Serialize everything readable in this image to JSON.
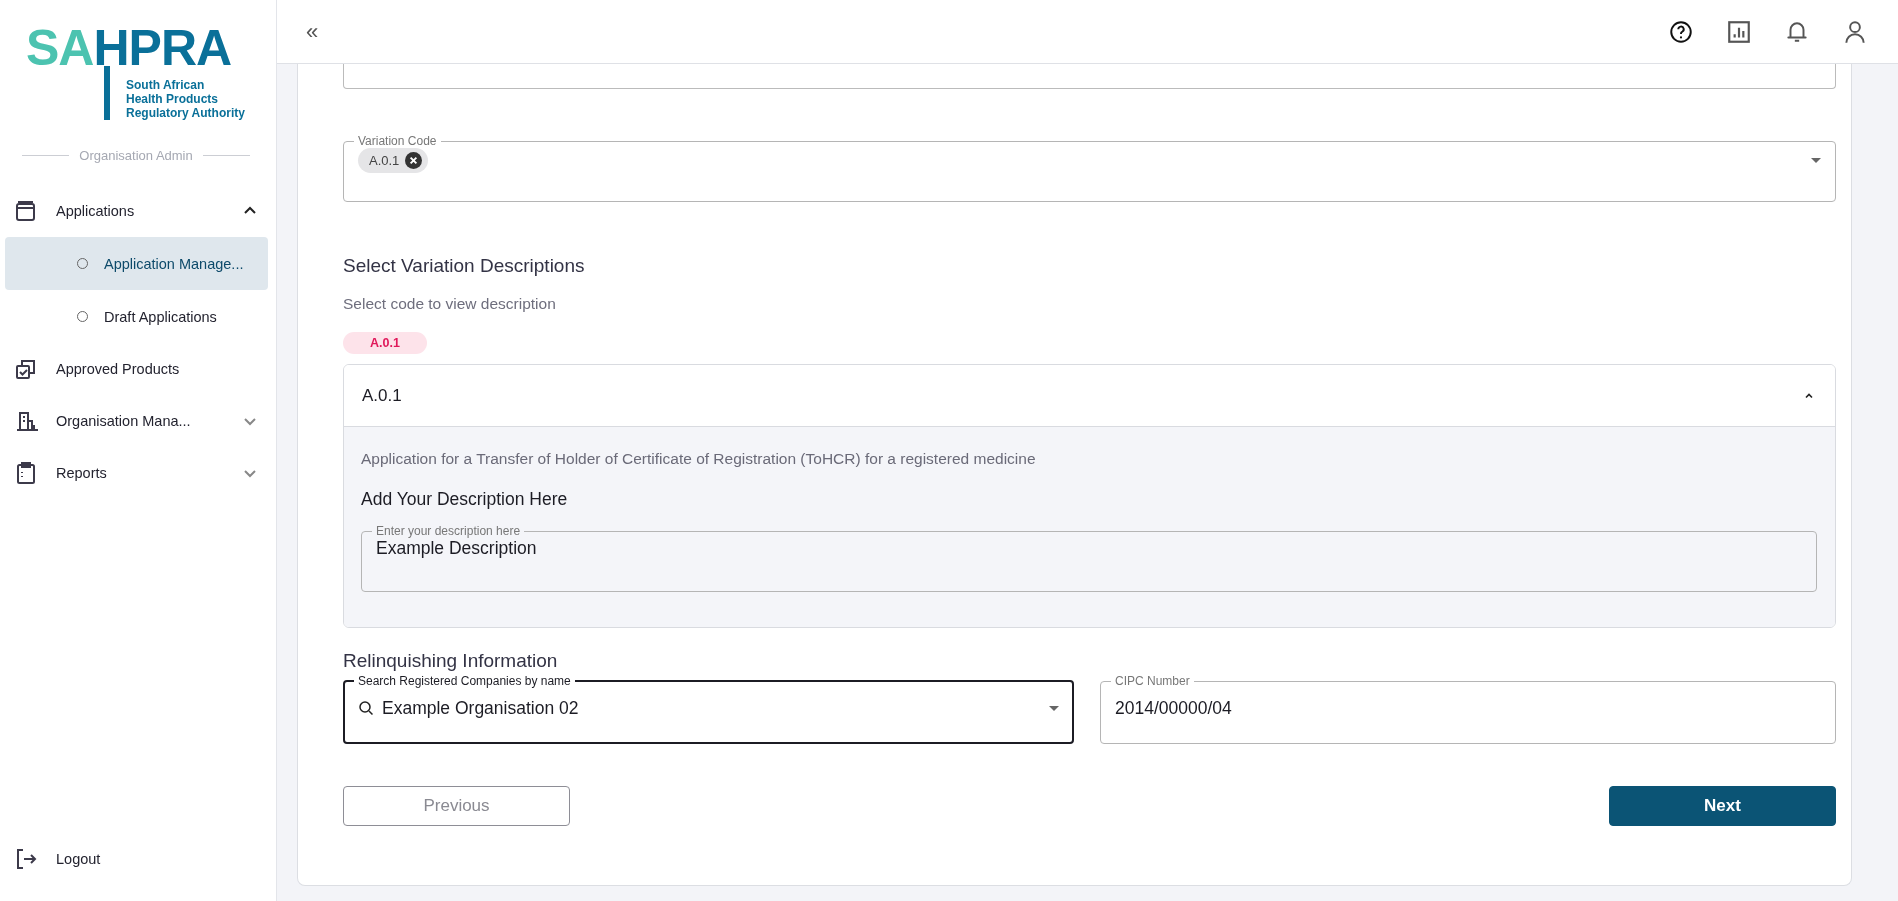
{
  "sidebar": {
    "logo": {
      "wordmark_part_1": "SA",
      "wordmark_part_2": "HPRA",
      "tagline": [
        "South African",
        "Health Products",
        "Regulatory Authority"
      ]
    },
    "section_label": "Organisation Admin",
    "items": [
      {
        "kind": "group",
        "label": "Applications",
        "expanded": true,
        "children": [
          {
            "label": "Application Manage...",
            "selected": true
          },
          {
            "label": "Draft Applications",
            "selected": false
          }
        ]
      },
      {
        "kind": "link",
        "label": "Approved Products"
      },
      {
        "kind": "group",
        "label": "Organisation Mana...",
        "expanded": false
      },
      {
        "kind": "group",
        "label": "Reports",
        "expanded": false
      }
    ],
    "logout": "Logout"
  },
  "header": {
    "collapse_glyph": "«"
  },
  "form": {
    "variation_code": {
      "label": "Variation Code",
      "chips": [
        "A.0.1"
      ]
    },
    "descriptions": {
      "heading": "Select Variation Descriptions",
      "hint": "Select code to view description",
      "code_tags": [
        "A.0.1"
      ],
      "accordion": {
        "title": "A.0.1",
        "expanded": true,
        "description": "Application for a Transfer of Holder of Certificate of Registration (ToHCR) for a registered medicine",
        "subheading": "Add Your Description Here",
        "field": {
          "label": "Enter your description here",
          "value": "Example Description"
        }
      }
    },
    "relinquishing": {
      "heading": "Relinquishing Information",
      "company_field": {
        "label": "Search Registered Companies by name",
        "value": "Example Organisation 02",
        "focused": true
      },
      "cipc_field": {
        "label": "CIPC Number",
        "value": "2014/00000/04",
        "focused": false
      }
    },
    "buttons": [
      {
        "label": "Previous",
        "kind": "secondary"
      },
      {
        "label": "Next",
        "kind": "primary"
      }
    ]
  }
}
